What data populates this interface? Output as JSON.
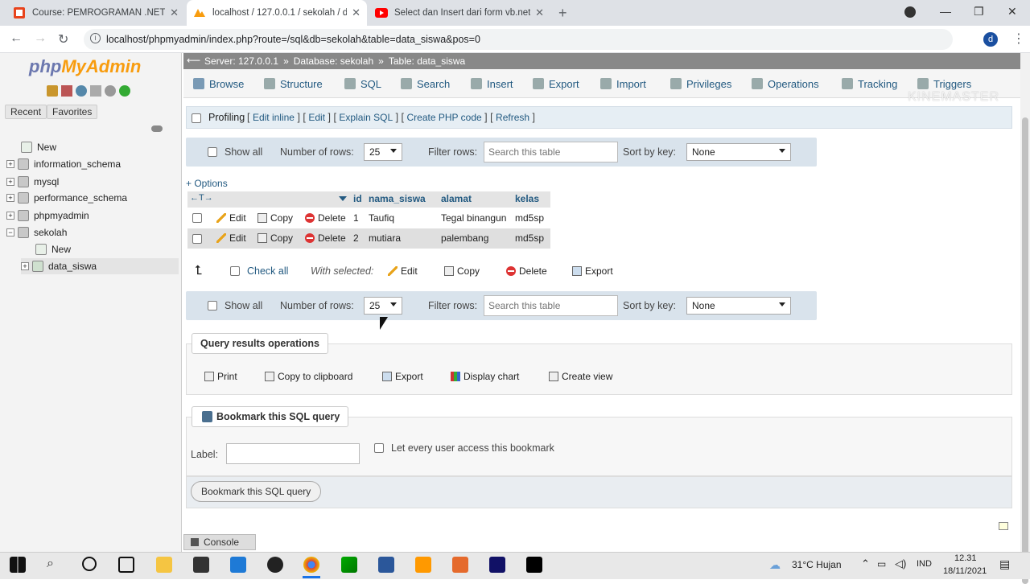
{
  "browser": {
    "tabs": [
      {
        "title": "Course: PEMROGRAMAN .NET L",
        "icon": "course-favicon"
      },
      {
        "title": "localhost / 127.0.0.1 / sekolah / d",
        "icon": "phpmyadmin-favicon"
      },
      {
        "title": "Select dan Insert dari form vb.net",
        "icon": "youtube-favicon"
      }
    ],
    "url": "localhost/phpmyadmin/index.php?route=/sql&db=sekolah&table=data_siswa&pos=0",
    "profile_initial": "d"
  },
  "sidebar": {
    "logo_php": "php",
    "logo_myadmin": "MyAdmin",
    "recent_label": "Recent",
    "favorites_label": "Favorites",
    "tree": [
      {
        "label": "New",
        "level": 0
      },
      {
        "label": "information_schema",
        "level": 0
      },
      {
        "label": "mysql",
        "level": 0
      },
      {
        "label": "performance_schema",
        "level": 0
      },
      {
        "label": "phpmyadmin",
        "level": 0
      },
      {
        "label": "sekolah",
        "level": 0
      },
      {
        "label": "New",
        "level": 1
      },
      {
        "label": "data_siswa",
        "level": 1
      }
    ]
  },
  "breadcrumb": {
    "server": "Server: 127.0.0.1",
    "database": "Database: sekolah",
    "table": "Table: data_siswa"
  },
  "main_tabs": [
    "Browse",
    "Structure",
    "SQL",
    "Search",
    "Insert",
    "Export",
    "Import",
    "Privileges",
    "Operations",
    "Tracking",
    "Triggers"
  ],
  "profiling": {
    "label": "Profiling",
    "links": [
      "Edit inline",
      "Edit",
      "Explain SQL",
      "Create PHP code",
      "Refresh"
    ]
  },
  "controls": {
    "show_all": "Show all",
    "number_of_rows_label": "Number of rows:",
    "number_of_rows_value": "25",
    "filter_rows_label": "Filter rows:",
    "filter_placeholder": "Search this table",
    "sort_by_key_label": "Sort by key:",
    "sort_by_key_value": "None"
  },
  "options_link": "+ Options",
  "table": {
    "columns": [
      "id",
      "nama_siswa",
      "alamat",
      "kelas"
    ],
    "actions": {
      "edit": "Edit",
      "copy": "Copy",
      "delete": "Delete"
    },
    "rows": [
      {
        "id": "1",
        "nama_siswa": "Taufiq",
        "alamat": "Tegal binangun",
        "kelas": "md5sp"
      },
      {
        "id": "2",
        "nama_siswa": "mutiara",
        "alamat": "palembang",
        "kelas": "md5sp"
      }
    ]
  },
  "bulk": {
    "check_all": "Check all",
    "with_selected": "With selected:",
    "edit": "Edit",
    "copy": "Copy",
    "delete": "Delete",
    "export": "Export"
  },
  "query_ops": {
    "title": "Query results operations",
    "print": "Print",
    "copy_clipboard": "Copy to clipboard",
    "export": "Export",
    "display_chart": "Display chart",
    "create_view": "Create view"
  },
  "bookmark": {
    "title": "Bookmark this SQL query",
    "label": "Label:",
    "every_user": "Let every user access this bookmark",
    "button": "Bookmark this SQL query"
  },
  "console_label": "Console",
  "watermark": "KINEMASTER",
  "taskbar": {
    "weather": "31°C  Hujan",
    "lang": "IND",
    "time": "12.31",
    "date": "18/11/2021"
  }
}
